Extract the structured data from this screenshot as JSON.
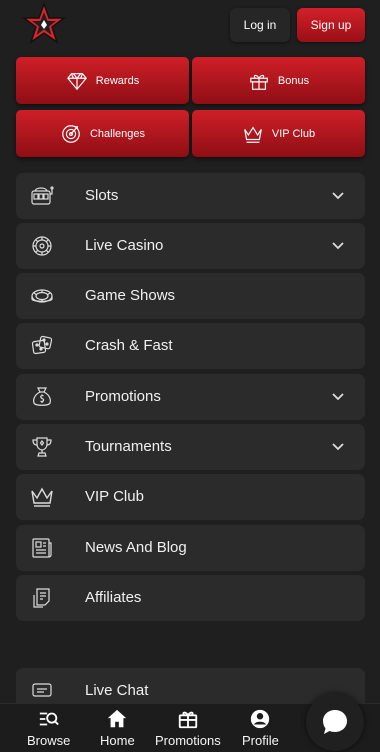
{
  "header": {
    "login_label": "Log in",
    "signup_label": "Sign up"
  },
  "tiles": [
    {
      "label": "Rewards",
      "icon": "diamond-icon"
    },
    {
      "label": "Bonus",
      "icon": "gift-icon"
    },
    {
      "label": "Challenges",
      "icon": "target-icon"
    },
    {
      "label": "VIP Club",
      "icon": "crown-icon"
    }
  ],
  "menu": [
    {
      "label": "Slots",
      "icon": "slot-machine-icon",
      "expandable": true
    },
    {
      "label": "Live Casino",
      "icon": "roulette-icon",
      "expandable": true
    },
    {
      "label": "Game Shows",
      "icon": "wheel-icon",
      "expandable": false
    },
    {
      "label": "Crash & Fast",
      "icon": "dice-icon",
      "expandable": false
    },
    {
      "label": "Promotions",
      "icon": "money-bag-icon",
      "expandable": true
    },
    {
      "label": "Tournaments",
      "icon": "trophy-icon",
      "expandable": true
    },
    {
      "label": "VIP Club",
      "icon": "crown-icon",
      "expandable": false
    },
    {
      "label": "News And Blog",
      "icon": "newspaper-icon",
      "expandable": false
    },
    {
      "label": "Affiliates",
      "icon": "affiliates-icon",
      "expandable": false
    },
    {
      "label": "Live Chat",
      "icon": "chat-icon",
      "expandable": false
    }
  ],
  "bottom_nav": [
    {
      "label": "Browse",
      "icon": "browse-icon"
    },
    {
      "label": "Home",
      "icon": "home-icon"
    },
    {
      "label": "Promotions",
      "icon": "gift-box-icon"
    },
    {
      "label": "Profile",
      "icon": "profile-icon"
    }
  ],
  "colors": {
    "accent": "#c81e26",
    "background": "#1f1f1f",
    "surface": "#2b2b2b"
  }
}
